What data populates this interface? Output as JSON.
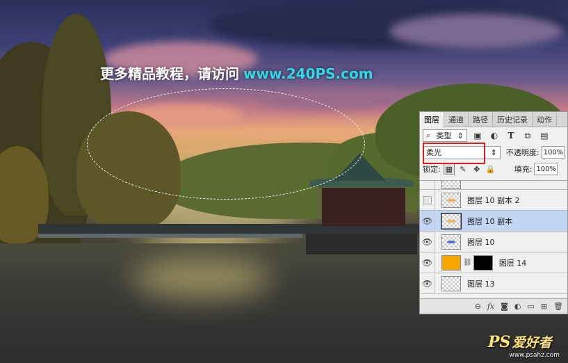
{
  "overlay": {
    "title": "更多精品教程，请访问",
    "url": "www.240PS.com"
  },
  "watermark": {
    "logo_latin": "PS",
    "logo_cn": "爱好者",
    "url": "www.psahz.com"
  },
  "panel": {
    "tabs": [
      "图层",
      "通道",
      "路径",
      "历史记录",
      "动作"
    ],
    "active_tab": "图层",
    "filter_kind": "类型",
    "blend_mode": "柔光",
    "opacity_label": "不透明度:",
    "opacity_value": "100%",
    "lock_label": "锁定:",
    "fill_label": "填充:",
    "fill_value": "100%",
    "layers": [
      {
        "name": "",
        "visible": true,
        "selected": false,
        "partial": true
      },
      {
        "name": "图层 10 副本 2",
        "visible": false,
        "selected": false
      },
      {
        "name": "图层 10 副本",
        "visible": true,
        "selected": true
      },
      {
        "name": "图层 10",
        "visible": true,
        "selected": false
      },
      {
        "name": "图层 14",
        "visible": true,
        "selected": false,
        "fill_color": "#f5a400",
        "has_mask": true
      },
      {
        "name": "图层 13",
        "visible": true,
        "selected": false
      }
    ]
  },
  "colors": {
    "highlight_box": "#e21c1c",
    "url_text": "#2fd8e8",
    "selected_layer_bg": "#c3d6f6"
  }
}
